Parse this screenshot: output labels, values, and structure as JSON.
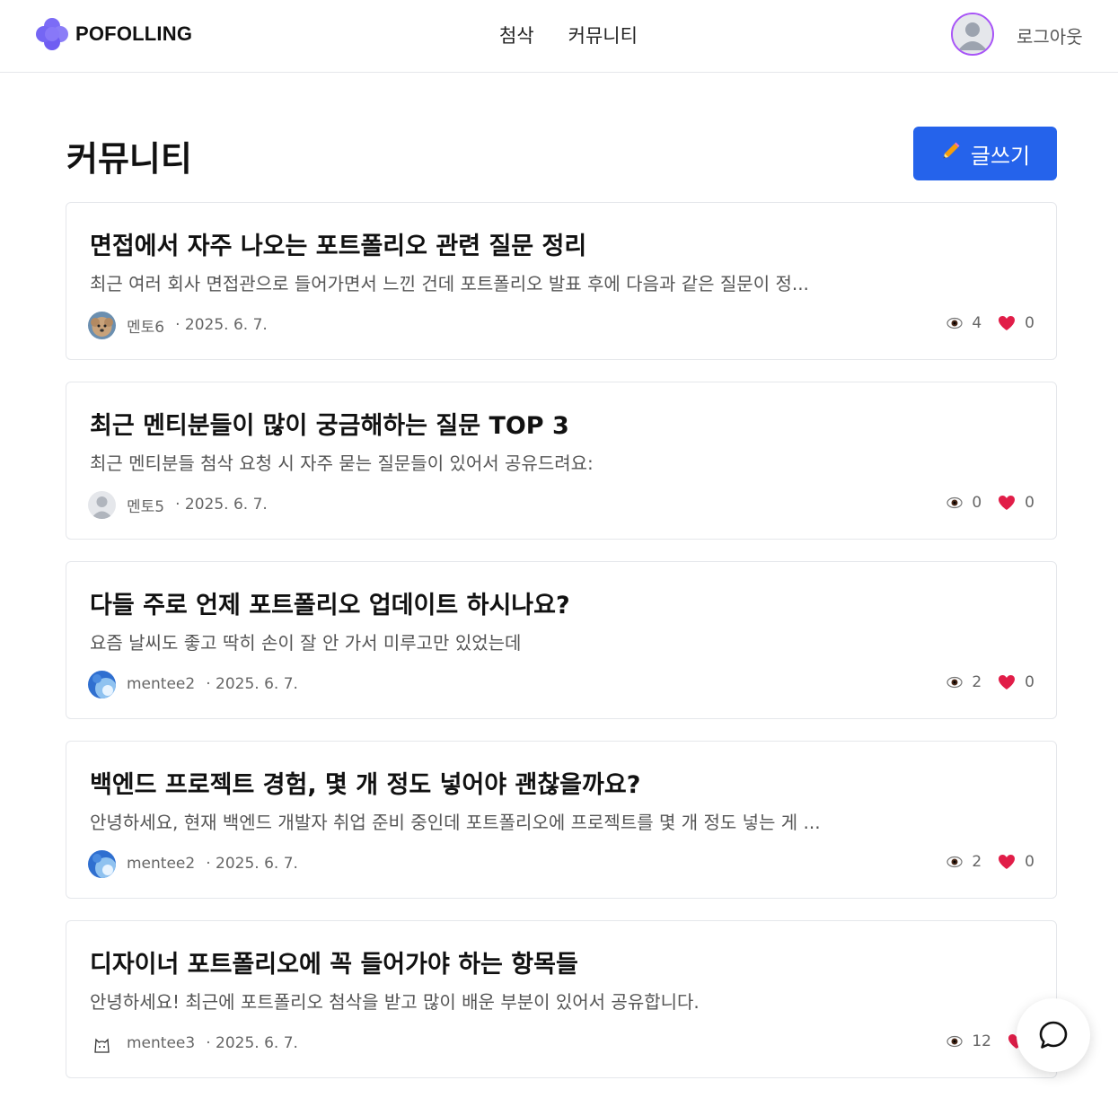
{
  "header": {
    "logo_text": "POFOLLING",
    "nav": [
      "첨삭",
      "커뮤니티"
    ],
    "logout_label": "로그아웃",
    "accent_color": "#a855f7"
  },
  "main": {
    "title": "커뮤니티",
    "write_button_label": "글쓰기",
    "button_color": "#2563eb"
  },
  "posts": [
    {
      "title": "면접에서 자주 나오는 포트폴리오 관련 질문 정리",
      "excerpt": "최근 여러 회사 면접관으로 들어가면서 느낀 건데 포트폴리오 발표 후에 다음과 같은 질문이 정...",
      "author": "멘토6",
      "date": "· 2025. 6. 7.",
      "views": "4",
      "likes": "0",
      "avatar": "dog-photo"
    },
    {
      "title": "최근 멘티분들이 많이 궁금해하는 질문 TOP 3",
      "excerpt": "최근 멘티분들 첨삭 요청 시 자주 묻는 질문들이 있어서 공유드려요:",
      "author": "멘토5",
      "date": "· 2025. 6. 7.",
      "views": "0",
      "likes": "0",
      "avatar": "default-user"
    },
    {
      "title": "다들 주로 언제 포트폴리오 업데이트 하시나요?",
      "excerpt": "요즘 날씨도 좋고 딱히 손이 잘 안 가서 미루고만 있었는데",
      "author": "mentee2",
      "date": "· 2025. 6. 7.",
      "views": "2",
      "likes": "0",
      "avatar": "sky-photo"
    },
    {
      "title": "백엔드 프로젝트 경험, 몇 개 정도 넣어야 괜찮을까요?",
      "excerpt": "안녕하세요, 현재 백엔드 개발자 취업 준비 중인데 포트폴리오에 프로젝트를 몇 개 정도 넣는 게 ...",
      "author": "mentee2",
      "date": "· 2025. 6. 7.",
      "views": "2",
      "likes": "0",
      "avatar": "sky-photo"
    },
    {
      "title": "디자이너 포트폴리오에 꼭 들어가야 하는 항목들",
      "excerpt": "안녕하세요! 최근에 포트폴리오 첨삭을 받고 많이 배운 부분이 있어서 공유합니다.",
      "author": "mentee3",
      "date": "· 2025. 6. 7.",
      "views": "12",
      "likes": "",
      "avatar": "cat-sketch"
    }
  ]
}
